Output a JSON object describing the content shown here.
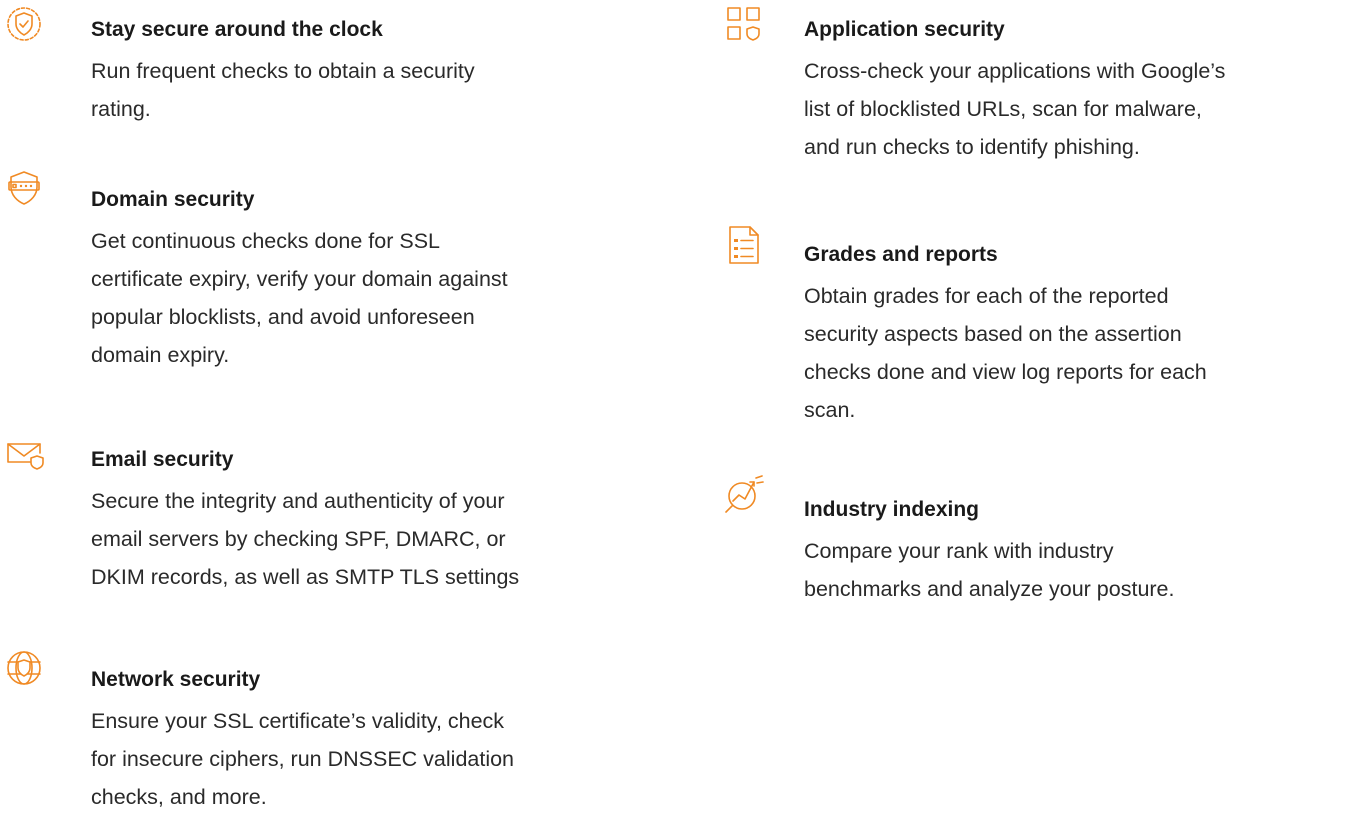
{
  "accent_color": "#f08a24",
  "left_column": [
    {
      "icon": "shield-check-clock-icon",
      "title": "Stay secure around the clock",
      "lines": [
        "Run frequent checks to obtain a security",
        "rating."
      ]
    },
    {
      "icon": "domain-shield-icon",
      "title": "Domain security",
      "lines": [
        "Get continuous checks done for SSL",
        "certificate expiry, verify your domain against",
        "popular blocklists, and avoid unforeseen",
        "domain expiry."
      ]
    },
    {
      "icon": "email-shield-icon",
      "title": "Email security",
      "lines": [
        "Secure the integrity and authenticity of your",
        "email servers by checking SPF, DMARC, or",
        "DKIM records, as well as SMTP TLS settings"
      ]
    },
    {
      "icon": "network-globe-shield-icon",
      "title": "Network security",
      "lines": [
        "Ensure your SSL certificate’s validity, check",
        "for insecure ciphers, run DNSSEC validation",
        "checks, and more."
      ]
    }
  ],
  "right_column": [
    {
      "icon": "application-grid-shield-icon",
      "title": "Application security",
      "lines": [
        "Cross-check your applications with Google’s",
        "list of blocklisted URLs, scan for malware,",
        "and run checks to identify phishing."
      ]
    },
    {
      "icon": "report-list-icon",
      "title": "Grades and reports",
      "lines": [
        "Obtain grades for each of the reported",
        "security aspects based on the assertion",
        "checks done and view log reports for each",
        "scan."
      ]
    },
    {
      "icon": "industry-index-magnifier-icon",
      "title": "Industry indexing",
      "lines": [
        "Compare your rank with industry",
        "benchmarks and analyze your posture."
      ]
    }
  ]
}
